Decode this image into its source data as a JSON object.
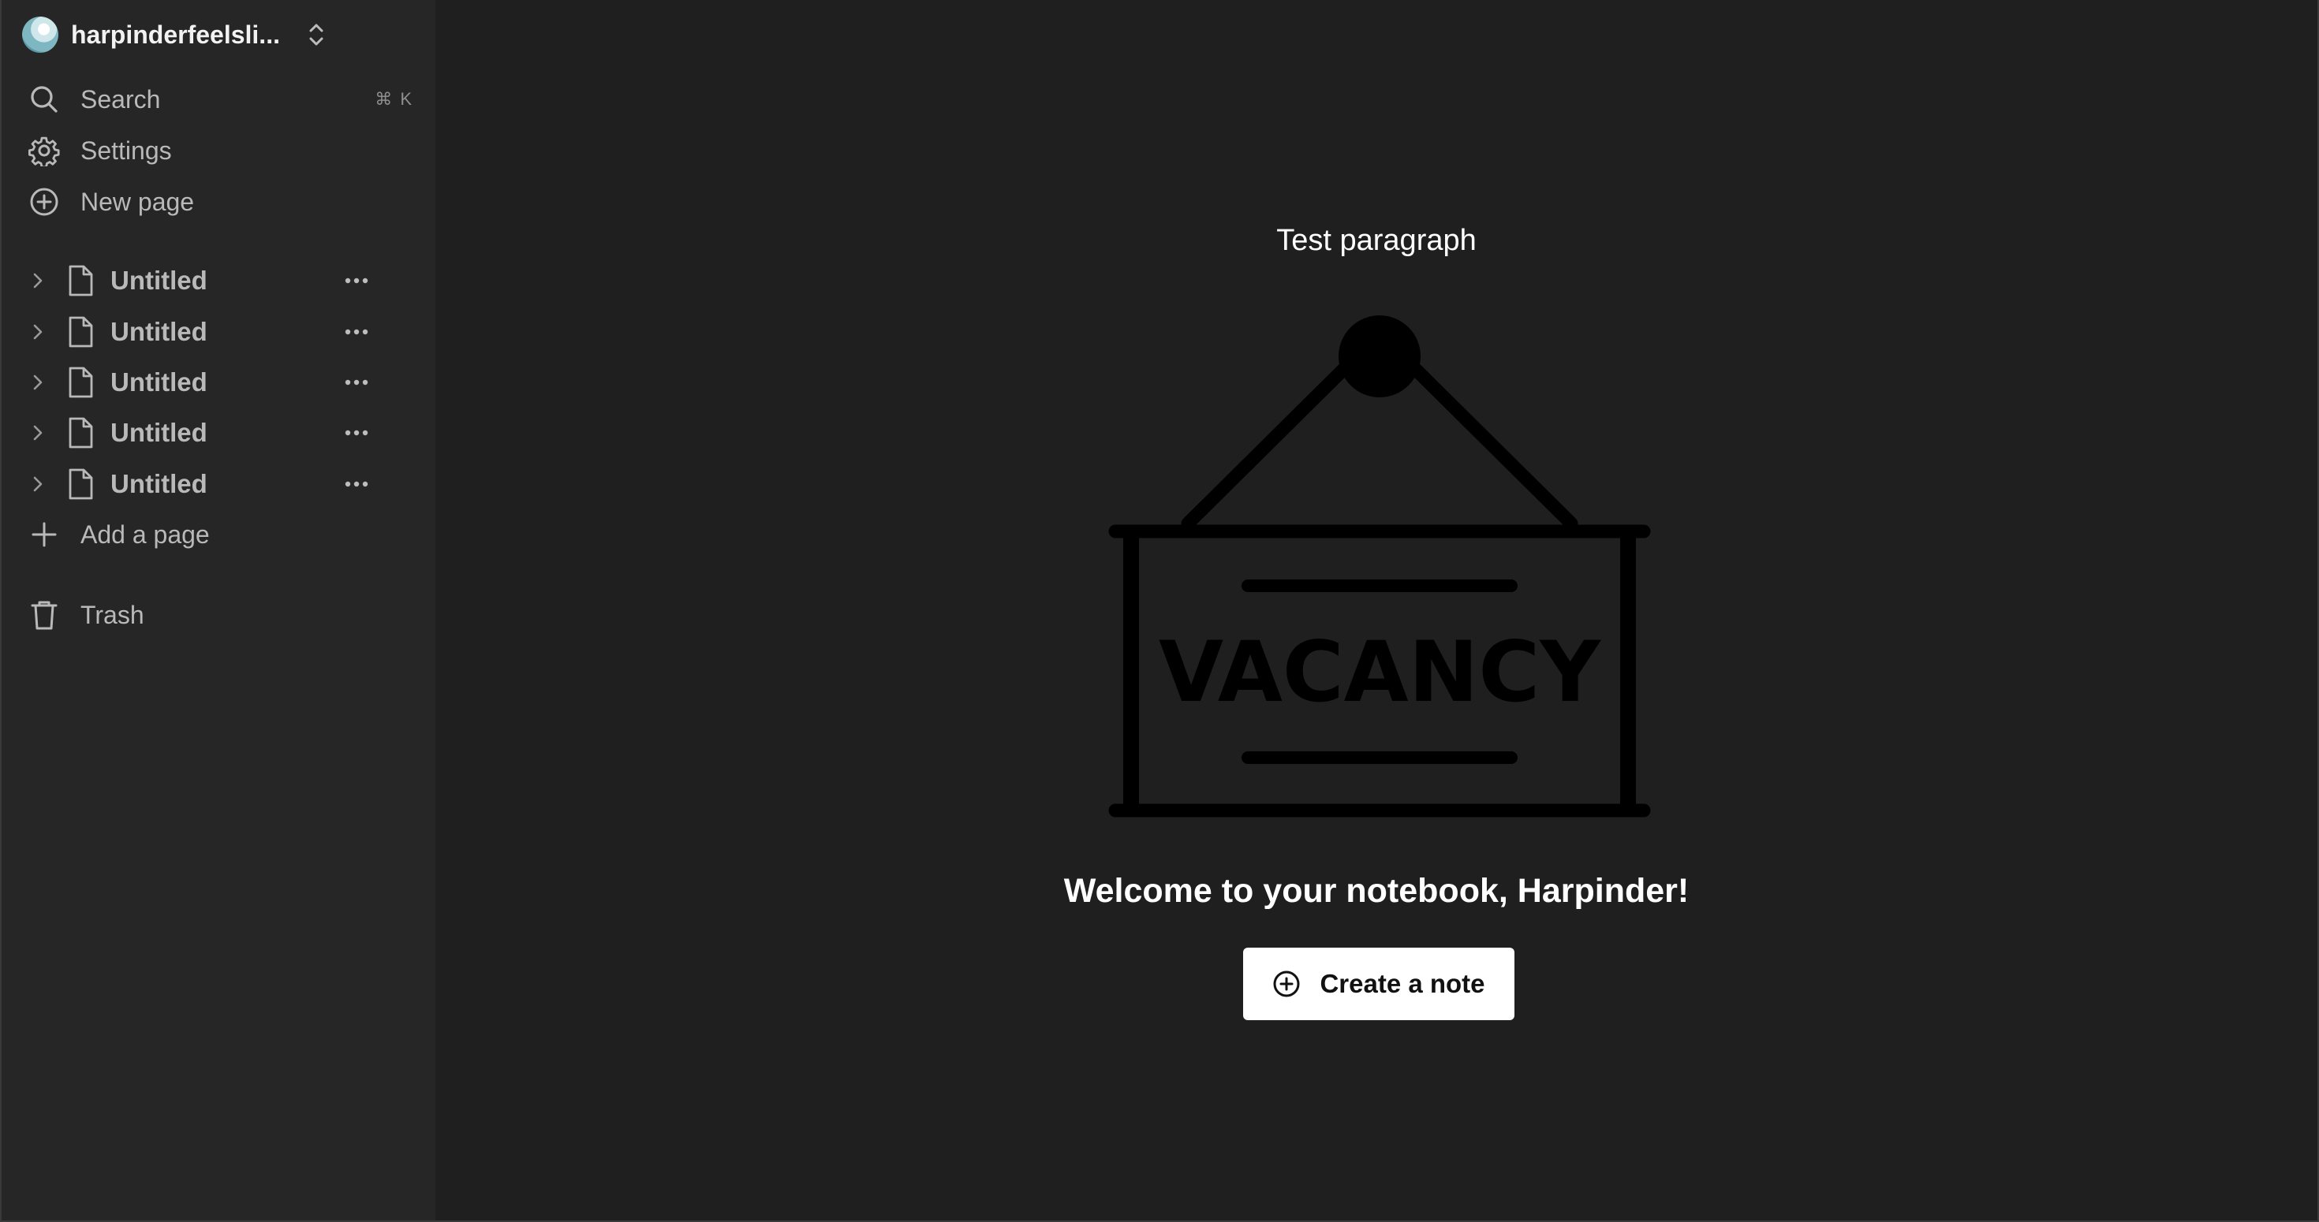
{
  "workspace": {
    "name": "harpinderfeelsli..."
  },
  "nav": {
    "search_label": "Search",
    "search_shortcut": "⌘ K",
    "settings_label": "Settings",
    "new_page_label": "New page"
  },
  "pages": [
    {
      "label": "Untitled"
    },
    {
      "label": "Untitled"
    },
    {
      "label": "Untitled"
    },
    {
      "label": "Untitled"
    },
    {
      "label": "Untitled"
    }
  ],
  "add_page_label": "Add a page",
  "trash_label": "Trash",
  "main": {
    "title": "Test paragraph",
    "illustration_text": "VACANCY",
    "welcome": "Welcome to your notebook, Harpinder!",
    "create_button_label": "Create a note"
  },
  "colors": {
    "sidebar_bg": "#262626",
    "main_bg": "#1f1f1f",
    "text_muted": "#b9b9b9",
    "button_bg": "#ffffff"
  },
  "icons": {
    "search": "search-icon",
    "settings": "gear-icon",
    "new_page": "plus-circle-icon",
    "page": "document-icon",
    "expand": "chevron-right-icon",
    "more": "ellipsis-icon",
    "add": "plus-icon",
    "trash": "trash-icon"
  }
}
